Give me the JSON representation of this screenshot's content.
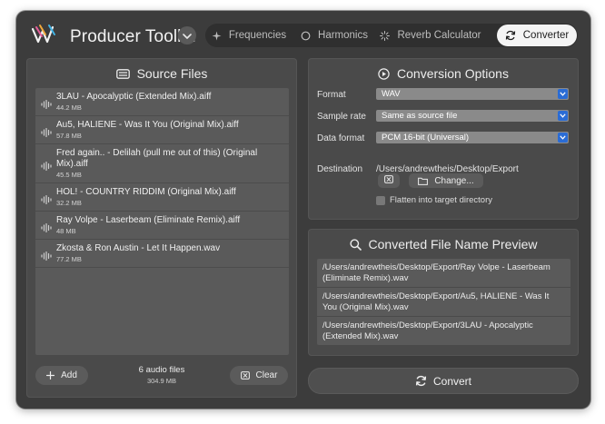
{
  "app": {
    "title": "Producer Toolkit"
  },
  "tabs": [
    {
      "label": "Frequencies",
      "icon": "sparkle-icon"
    },
    {
      "label": "Harmonics",
      "icon": "circle-icon"
    },
    {
      "label": "Reverb Calculator",
      "icon": "starburst-icon"
    },
    {
      "label": "Converter",
      "icon": "refresh-icon",
      "active": true
    }
  ],
  "source": {
    "title": "Source Files",
    "files": [
      {
        "name": "3LAU - Apocalyptic (Extended Mix).aiff",
        "size": "44.2 MB"
      },
      {
        "name": "Au5, HALIENE - Was It You (Original Mix).aiff",
        "size": "57.8 MB"
      },
      {
        "name": "Fred again.. - Delilah (pull me out of this) (Original Mix).aiff",
        "size": "45.5 MB"
      },
      {
        "name": "HOL! - COUNTRY RIDDIM (Original Mix).aiff",
        "size": "32.2 MB"
      },
      {
        "name": "Ray Volpe - Laserbeam (Eliminate Remix).aiff",
        "size": "48 MB"
      },
      {
        "name": "Zkosta & Ron Austin - Let It Happen.wav",
        "size": "77.2 MB"
      }
    ],
    "add_label": "Add",
    "summary_count": "6 audio files",
    "summary_size": "304.9 MB",
    "clear_label": "Clear"
  },
  "options": {
    "title": "Conversion Options",
    "format_label": "Format",
    "format_value": "WAV",
    "sample_rate_label": "Sample rate",
    "sample_rate_value": "Same as source file",
    "data_format_label": "Data format",
    "data_format_value": "PCM 16-bit (Universal)",
    "destination_label": "Destination",
    "destination_value": "/Users/andrewtheis/Desktop/Export",
    "change_label": "Change...",
    "flatten_label": "Flatten into target directory",
    "flatten_checked": false
  },
  "preview": {
    "title": "Converted File Name Preview",
    "items": [
      "/Users/andrewtheis/Desktop/Export/Ray Volpe - Laserbeam (Eliminate Remix).wav",
      "/Users/andrewtheis/Desktop/Export/Au5, HALIENE - Was It You (Original Mix).wav",
      "/Users/andrewtheis/Desktop/Export/3LAU - Apocalyptic (Extended Mix).wav"
    ]
  },
  "convert_label": "Convert",
  "colors": {
    "accent": "#2a6cd5",
    "window": "#3c3c3c",
    "panel": "#4a4a4a",
    "list": "#5a5a5a"
  }
}
